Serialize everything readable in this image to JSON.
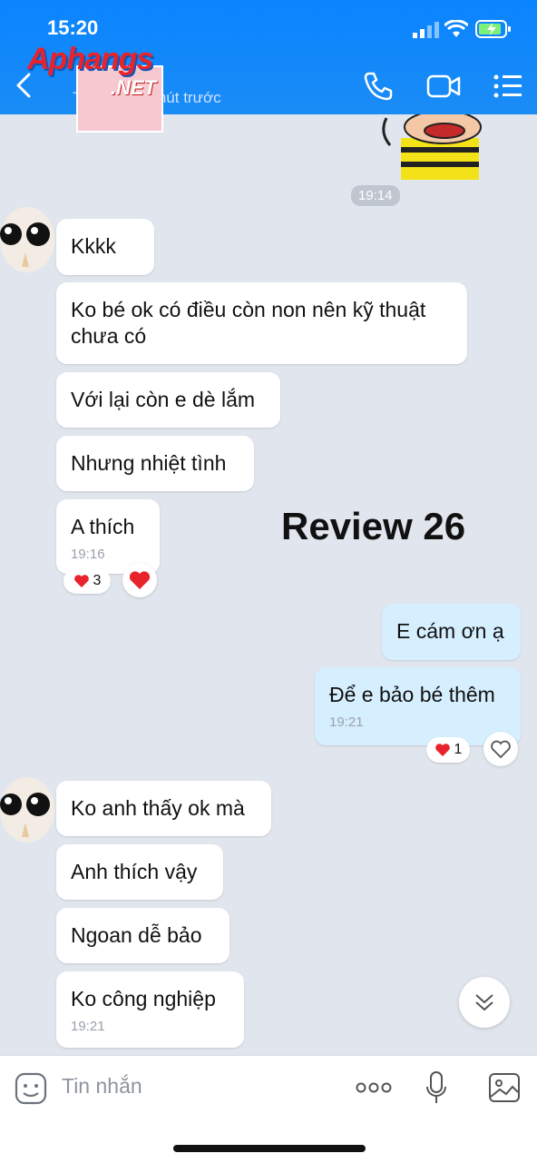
{
  "status": {
    "time": "15:20"
  },
  "header": {
    "subtitle": "Truy cập 1 phút trước"
  },
  "watermark": {
    "brand": "Aphangs",
    "domain": ".NET"
  },
  "messages": {
    "time_pill": "19:14",
    "in1": "Kkkk",
    "in2": "Ko bé ok có điều còn non nên kỹ thuật chưa có",
    "in3": "Với lại còn e dè lắm",
    "in4": "Nhưng nhiệt tình",
    "in5": "A thích",
    "in5_time": "19:16",
    "in5_reactions": "3",
    "out1": "E cám ơn ạ",
    "out2": "Để e bảo bé thêm",
    "out2_time": "19:21",
    "out2_reactions": "1",
    "in6": "Ko anh thấy ok mà",
    "in7": "Anh thích vậy",
    "in8": "Ngoan dễ bảo",
    "in9": "Ko công nghiệp",
    "in9_time": "19:21"
  },
  "overlay": {
    "label": "Review 26"
  },
  "composer": {
    "placeholder": "Tin nhắn"
  },
  "colors": {
    "header": "#0a84ff",
    "outgoing": "#d6efff",
    "heart": "#e8232b"
  }
}
